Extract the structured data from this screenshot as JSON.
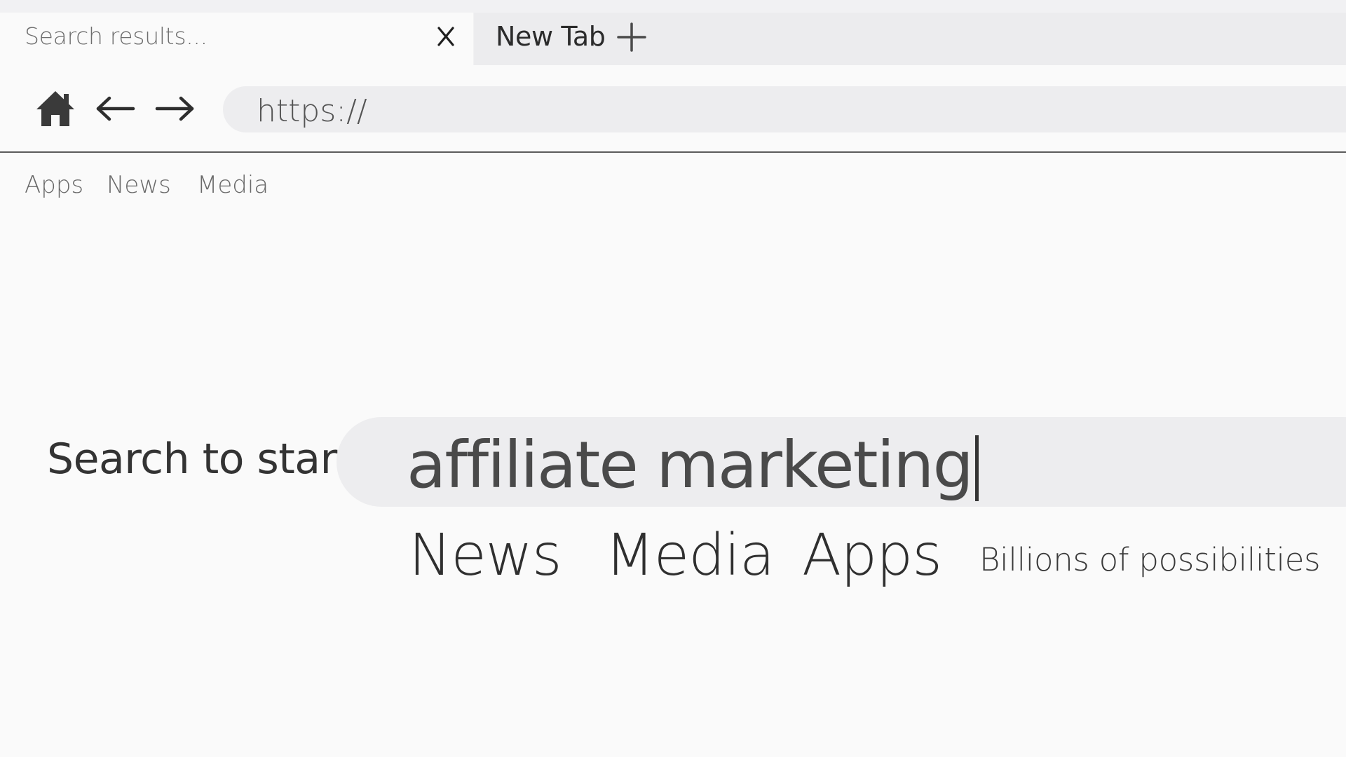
{
  "tabs": {
    "active": {
      "title": "Search results...",
      "close_icon": "close-icon"
    },
    "new": {
      "title": "New Tab",
      "add_icon": "plus-icon"
    }
  },
  "nav": {
    "home_icon": "home-icon",
    "back_icon": "arrow-left-icon",
    "forward_icon": "arrow-right-icon",
    "address": "https://"
  },
  "bookmarks": [
    "Apps",
    "News",
    "Media"
  ],
  "search": {
    "label": "Search to start",
    "value": "affiliate marketing"
  },
  "categories": [
    "News",
    "Media",
    "Apps"
  ],
  "tagline": "Billions of possibilities",
  "colors": {
    "page_bg": "#fafafa",
    "tabstrip_bg": "#f1f1f3",
    "pill_bg": "#ededef",
    "text": "#333333",
    "divider": "#5b5b5b"
  }
}
